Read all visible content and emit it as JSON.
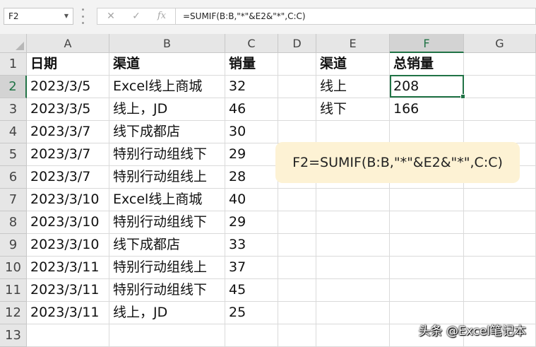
{
  "formula_bar": {
    "name_box": "F2",
    "cancel_icon": "✕",
    "enter_icon": "✓",
    "fx_label": "fx",
    "formula": "=SUMIF(B:B,\"*\"&E2&\"*\",C:C)"
  },
  "columns": [
    "A",
    "B",
    "C",
    "D",
    "E",
    "F",
    "G"
  ],
  "selected_column": "F",
  "row_numbers": [
    "1",
    "2",
    "3",
    "4",
    "5",
    "6",
    "7",
    "8",
    "9",
    "10",
    "11",
    "12",
    "13"
  ],
  "selected_row": "2",
  "data_table": {
    "headers": [
      "日期",
      "渠道",
      "销量"
    ],
    "rows": [
      [
        "2023/3/5",
        "Excel线上商城",
        "32"
      ],
      [
        "2023/3/5",
        "线上，JD",
        "46"
      ],
      [
        "2023/3/7",
        "线下成都店",
        "30"
      ],
      [
        "2023/3/7",
        "特别行动组线下",
        "29"
      ],
      [
        "2023/3/7",
        "特别行动组线上",
        "28"
      ],
      [
        "2023/3/10",
        "Excel线上商城",
        "40"
      ],
      [
        "2023/3/10",
        "特别行动组线下",
        "29"
      ],
      [
        "2023/3/10",
        "线下成都店",
        "33"
      ],
      [
        "2023/3/11",
        "特别行动组线上",
        "37"
      ],
      [
        "2023/3/11",
        "特别行动组线下",
        "45"
      ],
      [
        "2023/3/11",
        "线上，JD",
        "25"
      ]
    ]
  },
  "summary_table": {
    "headers": [
      "渠道",
      "总销量"
    ],
    "rows": [
      [
        "线上",
        "208"
      ],
      [
        "线下",
        "166"
      ]
    ]
  },
  "callout": "F2=SUMIF(B:B,\"*\"&E2&\"*\",C:C)",
  "watermark": "头条 @Excel笔记本",
  "colors": {
    "accent": "#217346",
    "callout_bg": "#fdf2d4"
  }
}
